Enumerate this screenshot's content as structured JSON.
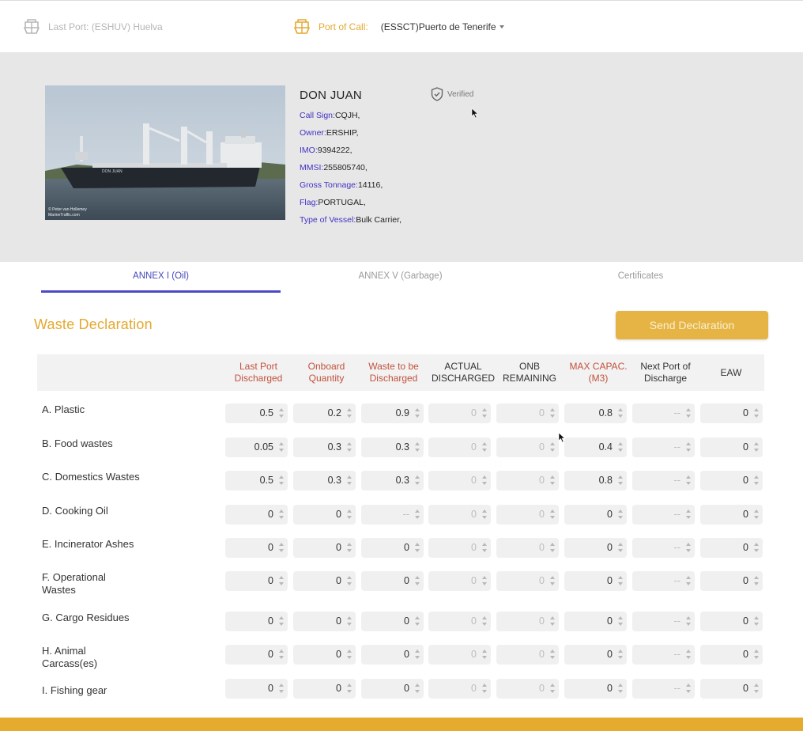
{
  "header": {
    "last_port": "Last Port: (ESHUV) Huelva",
    "port_of_call_label": "Port of Call:",
    "port_of_call_value": "(ESSCT)Puerto de Tenerife"
  },
  "vessel": {
    "photo_credit_1": "© Peter van Hollemey",
    "photo_credit_2": "MarineTraffic.com",
    "hull_name": "DON JUAN",
    "name": "DON JUAN",
    "verified": "Verified",
    "fields": [
      {
        "key": "Call Sign:",
        "value": "CQJH,"
      },
      {
        "key": "Owner:",
        "value": "ERSHIP,"
      },
      {
        "key": "IMO:",
        "value": "9394222,"
      },
      {
        "key": "MMSI:",
        "value": "255805740,"
      },
      {
        "key": "Gross Tonnage:",
        "value": "14116,"
      },
      {
        "key": "Flag:",
        "value": "PORTUGAL,"
      },
      {
        "key": "Type of Vessel:",
        "value": "Bulk Carrier,"
      }
    ]
  },
  "tabs": [
    {
      "label": "ANNEX I (Oil)",
      "active": true
    },
    {
      "label": "ANNEX V (Garbage)",
      "active": false
    },
    {
      "label": "Certificates",
      "active": false
    }
  ],
  "waste": {
    "title": "Waste Declaration",
    "send_button": "Send Declaration",
    "columns": [
      {
        "label": "Last Port Discharged",
        "highlight": true
      },
      {
        "label": "Onboard Quantity",
        "highlight": true
      },
      {
        "label": "Waste to be Discharged",
        "highlight": true
      },
      {
        "label": "ACTUAL DISCHARGED",
        "highlight": false
      },
      {
        "label": "ONB REMAINING",
        "highlight": false
      },
      {
        "label": "MAX CAPAC. (M3)",
        "highlight": true
      },
      {
        "label": "Next Port of Discharge",
        "highlight": false
      },
      {
        "label": "EAW",
        "highlight": false
      }
    ],
    "rows": [
      {
        "label": "A. Plastic",
        "values": [
          "0.5",
          "0.2",
          "0.9",
          "0",
          "0",
          "0.8",
          "--",
          "0"
        ]
      },
      {
        "label": "B. Food wastes",
        "values": [
          "0.05",
          "0.3",
          "0.3",
          "0",
          "0",
          "0.4",
          "--",
          "0"
        ]
      },
      {
        "label": "C. Domestics Wastes",
        "values": [
          "0.5",
          "0.3",
          "0.3",
          "0",
          "0",
          "0.8",
          "--",
          "0"
        ]
      },
      {
        "label": "D. Cooking Oil",
        "values": [
          "0",
          "0",
          "--",
          "0",
          "0",
          "0",
          "--",
          "0"
        ]
      },
      {
        "label": "E. Incinerator Ashes",
        "values": [
          "0",
          "0",
          "0",
          "0",
          "0",
          "0",
          "--",
          "0"
        ]
      },
      {
        "label": "F. Operational Wastes",
        "values": [
          "0",
          "0",
          "0",
          "0",
          "0",
          "0",
          "--",
          "0"
        ]
      },
      {
        "label": "G. Cargo Residues",
        "values": [
          "0",
          "0",
          "0",
          "0",
          "0",
          "0",
          "--",
          "0"
        ]
      },
      {
        "label": "H. Animal Carcass(es)",
        "values": [
          "0",
          "0",
          "0",
          "0",
          "0",
          "0",
          "--",
          "0"
        ]
      },
      {
        "label": "I. Fishing gear",
        "values": [
          "0",
          "0",
          "0",
          "0",
          "0",
          "0",
          "--",
          "0"
        ]
      }
    ]
  },
  "colors": {
    "accent": "#e3a92f",
    "tab_active": "#4a4ac4",
    "vessel_key": "#3f33c4",
    "column_highlight": "#c2513d"
  }
}
